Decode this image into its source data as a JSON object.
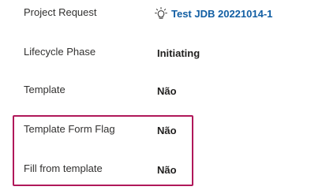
{
  "fields": [
    {
      "label": "Project Request",
      "value": "Test JDB 20221014-1",
      "icon": "lightbulb-icon",
      "link_color": "#115ea3"
    },
    {
      "label": "Lifecycle Phase",
      "value": "Initiating"
    },
    {
      "label": "Template",
      "value": "Não"
    },
    {
      "label": "Template Form Flag",
      "value": "Não"
    },
    {
      "label": "Fill from template",
      "value": "Não"
    }
  ],
  "highlight_color": "#b0185a"
}
